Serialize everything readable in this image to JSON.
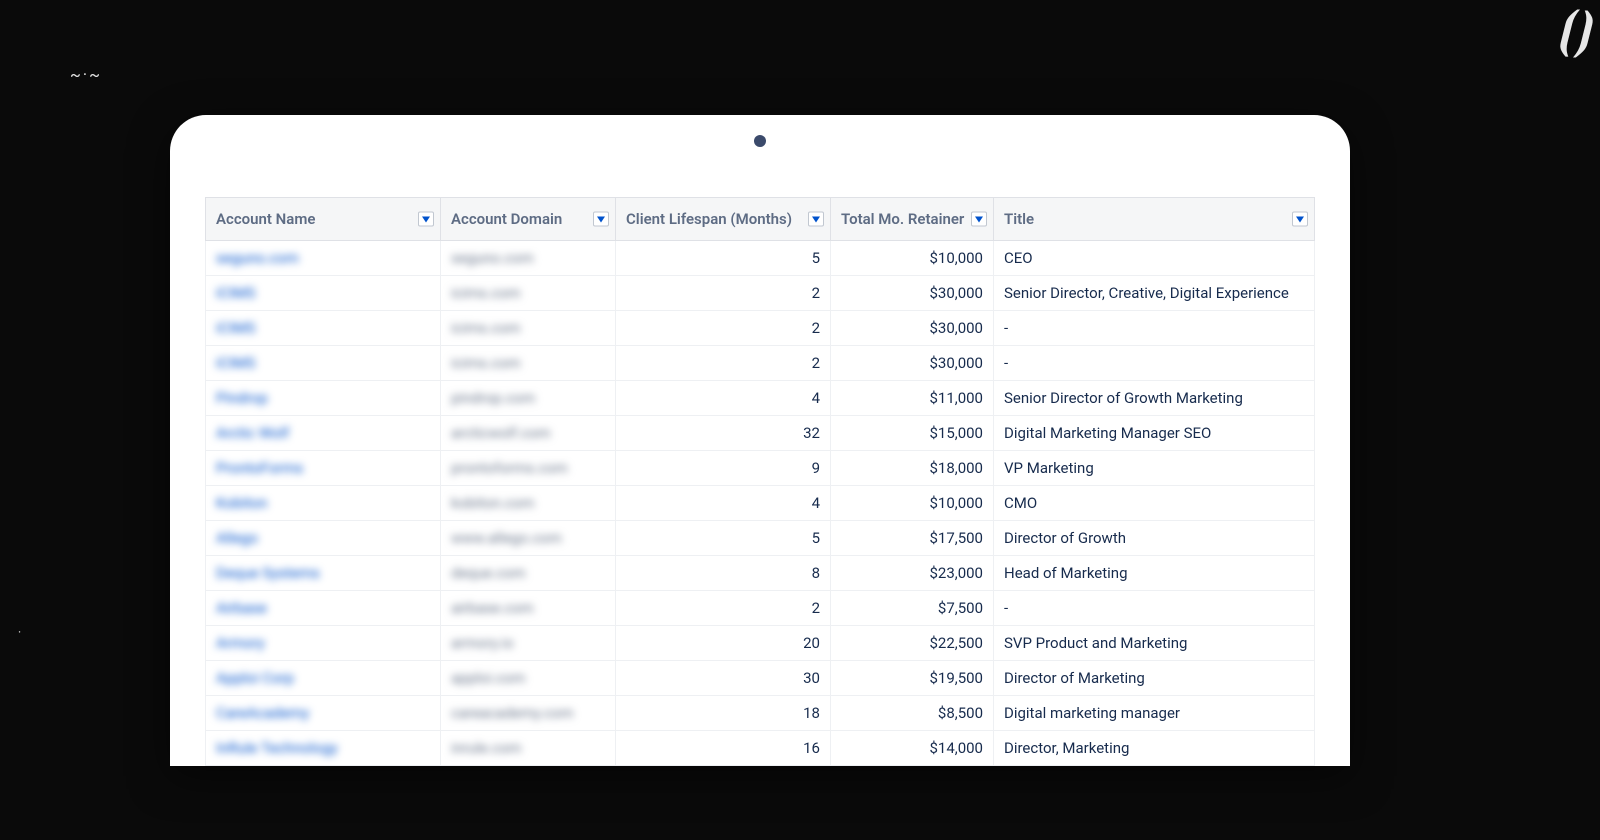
{
  "columns": [
    {
      "key": "account_name",
      "label": "Account Name"
    },
    {
      "key": "account_domain",
      "label": "Account Domain"
    },
    {
      "key": "lifespan",
      "label": "Client Lifespan (Months)"
    },
    {
      "key": "retainer",
      "label": "Total Mo. Retainer"
    },
    {
      "key": "title",
      "label": "Title"
    }
  ],
  "rows": [
    {
      "account_name": "seguno.com",
      "account_domain": "seguno.com",
      "lifespan": "5",
      "retainer": "$10,000",
      "title": "CEO"
    },
    {
      "account_name": "iCIMS",
      "account_domain": "icims.com",
      "lifespan": "2",
      "retainer": "$30,000",
      "title": "Senior Director, Creative, Digital Experience"
    },
    {
      "account_name": "iCIMS",
      "account_domain": "icims.com",
      "lifespan": "2",
      "retainer": "$30,000",
      "title": "-"
    },
    {
      "account_name": "iCIMS",
      "account_domain": "icims.com",
      "lifespan": "2",
      "retainer": "$30,000",
      "title": "-"
    },
    {
      "account_name": "Pindrop",
      "account_domain": "pindrop.com",
      "lifespan": "4",
      "retainer": "$11,000",
      "title": "Senior Director of Growth Marketing"
    },
    {
      "account_name": "Arctic Wolf",
      "account_domain": "arcticwolf.com",
      "lifespan": "32",
      "retainer": "$15,000",
      "title": "Digital Marketing Manager SEO"
    },
    {
      "account_name": "ProntoForms",
      "account_domain": "prontoforms.com",
      "lifespan": "9",
      "retainer": "$18,000",
      "title": "VP Marketing"
    },
    {
      "account_name": "Kobiton",
      "account_domain": "kobiton.com",
      "lifespan": "4",
      "retainer": "$10,000",
      "title": "CMO"
    },
    {
      "account_name": "Allego",
      "account_domain": "www.allego.com",
      "lifespan": "5",
      "retainer": "$17,500",
      "title": "Director of Growth"
    },
    {
      "account_name": "Deque Systems",
      "account_domain": "deque.com",
      "lifespan": "8",
      "retainer": "$23,000",
      "title": "Head of Marketing"
    },
    {
      "account_name": "Airbase",
      "account_domain": "airbase.com",
      "lifespan": "2",
      "retainer": "$7,500",
      "title": "-"
    },
    {
      "account_name": "Armory",
      "account_domain": "armory.io",
      "lifespan": "20",
      "retainer": "$22,500",
      "title": "SVP Product and Marketing"
    },
    {
      "account_name": "Apploi Corp",
      "account_domain": "apploi.com",
      "lifespan": "30",
      "retainer": "$19,500",
      "title": "Director of Marketing"
    },
    {
      "account_name": "CareAcademy",
      "account_domain": "careacademy.com",
      "lifespan": "18",
      "retainer": "$8,500",
      "title": "Digital marketing manager"
    },
    {
      "account_name": "InRule Technology",
      "account_domain": "inrule.com",
      "lifespan": "16",
      "retainer": "$14,000",
      "title": "Director, Marketing"
    }
  ]
}
